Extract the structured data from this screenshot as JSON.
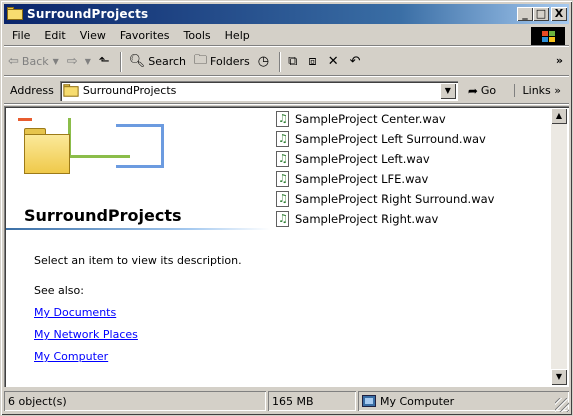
{
  "window": {
    "title": "SurroundProjects",
    "controls": {
      "minimize": "_",
      "maximize": "□",
      "close": "X"
    }
  },
  "menu": [
    "File",
    "Edit",
    "View",
    "Favorites",
    "Tools",
    "Help"
  ],
  "toolbar": {
    "back_label": "Back",
    "search_label": "Search",
    "folders_label": "Folders",
    "more": "»"
  },
  "address": {
    "label": "Address",
    "value": "SurroundProjects",
    "go_label": "Go",
    "links_label": "Links »"
  },
  "left_pane": {
    "title": "SurroundProjects",
    "description": "Select an item to view its description.",
    "see_also_label": "See also:",
    "links": [
      "My Documents",
      "My Network Places",
      "My Computer"
    ]
  },
  "files": [
    "SampleProject Center.wav",
    "SampleProject Left Surround.wav",
    "SampleProject Left.wav",
    "SampleProject LFE.wav",
    "SampleProject Right Surround.wav",
    "SampleProject Right.wav"
  ],
  "status": {
    "objects": "6 object(s)",
    "size": "165 MB",
    "zone": "My Computer"
  },
  "colors": {
    "titlebar_start": "#0a246a",
    "titlebar_end": "#a6caf0",
    "link": "#0000ff",
    "chrome": "#d4d0c8"
  }
}
